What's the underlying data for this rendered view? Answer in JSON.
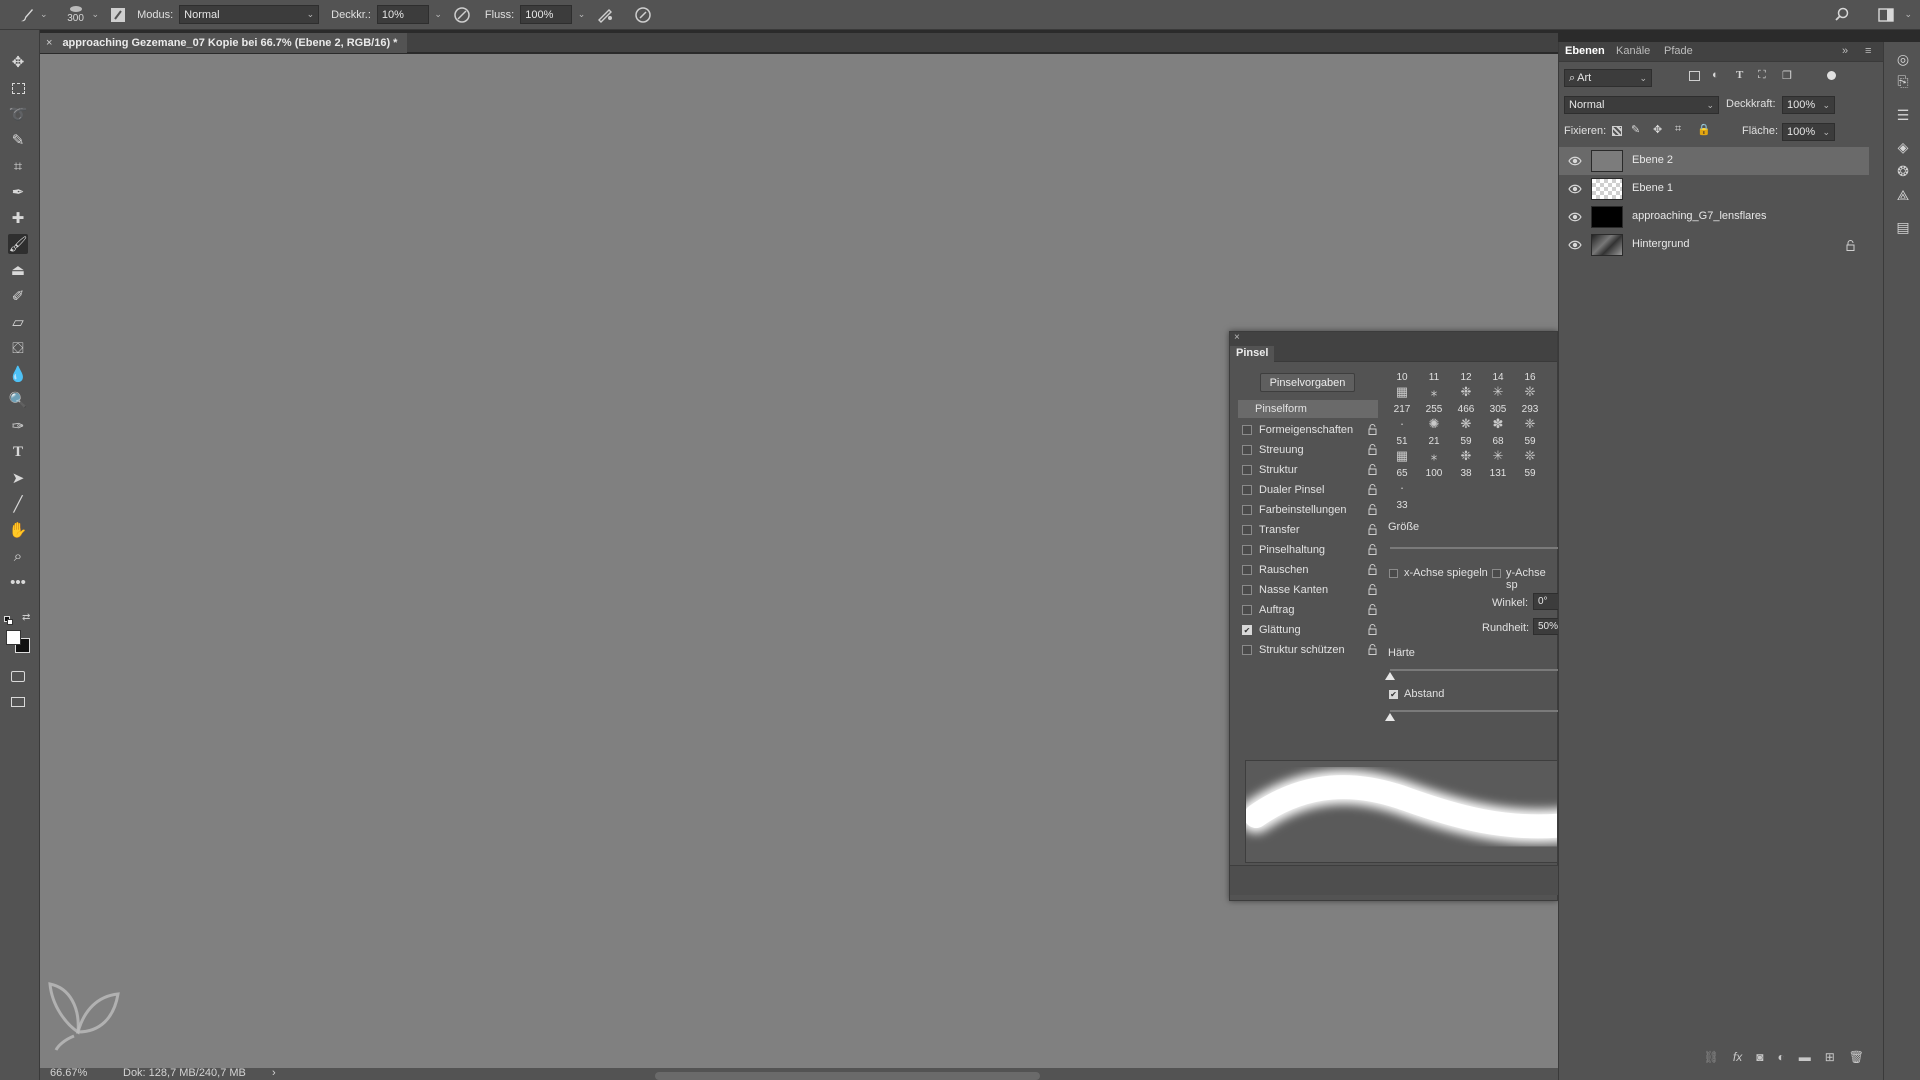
{
  "options_bar": {
    "brush_size": "300",
    "mode_label": "Modus:",
    "mode_value": "Normal",
    "opacity_label": "Deckkr.:",
    "opacity_value": "10%",
    "flow_label": "Fluss:",
    "flow_value": "100%"
  },
  "document": {
    "tab_title": "approaching Gezemane_07 Kopie bei 66.7% (Ebene 2, RGB/16) *",
    "zoom": "66.67%",
    "doc_size": "Dok: 128,7 MB/240,7 MB",
    "canvas_color": "#808080"
  },
  "brush_panel": {
    "title": "Pinsel",
    "presets_button": "Pinselvorgaben",
    "selected_section": "Pinselform",
    "options": [
      {
        "label": "Formeigenschaften",
        "checked": false
      },
      {
        "label": "Streuung",
        "checked": false
      },
      {
        "label": "Struktur",
        "checked": false
      },
      {
        "label": "Dualer Pinsel",
        "checked": false
      },
      {
        "label": "Farbeinstellungen",
        "checked": false
      },
      {
        "label": "Transfer",
        "checked": false
      },
      {
        "label": "Pinselhaltung",
        "checked": false
      },
      {
        "label": "Rauschen",
        "checked": false
      },
      {
        "label": "Nasse Kanten",
        "checked": false
      },
      {
        "label": "Auftrag",
        "checked": false
      },
      {
        "label": "Glättung",
        "checked": true
      },
      {
        "label": "Struktur schützen",
        "checked": false
      }
    ],
    "tip_sizes_row1": [
      "10",
      "11",
      "12",
      "14",
      "16"
    ],
    "tip_sizes_row2": [
      "217",
      "255",
      "466",
      "305",
      "293"
    ],
    "tip_sizes_row3": [
      "51",
      "21",
      "59",
      "68",
      "59"
    ],
    "tip_sizes_row4": [
      "65",
      "100",
      "38",
      "131",
      "59"
    ],
    "tip_sizes_row5": [
      "33"
    ],
    "size_label": "Größe",
    "flip_x_label": "x-Achse spiegeln",
    "flip_y_label": "y-Achse sp",
    "angle_label": "Winkel:",
    "angle_value": "0°",
    "roundness_label": "Rundheit:",
    "roundness_value": "50%",
    "hardness_label": "Härte",
    "spacing_label": "Abstand",
    "spacing_checked": true
  },
  "layers_panel": {
    "tabs": [
      "Ebenen",
      "Kanäle",
      "Pfade"
    ],
    "filter_value": "Art",
    "blend_mode": "Normal",
    "opacity_label": "Deckkraft:",
    "opacity_value": "100%",
    "lock_label": "Fixieren:",
    "fill_label": "Fläche:",
    "fill_value": "100%",
    "layers": [
      {
        "name": "Ebene 2",
        "selected": true,
        "locked": false
      },
      {
        "name": "Ebene 1",
        "selected": false,
        "locked": false
      },
      {
        "name": "approaching_G7_lensflares",
        "selected": false,
        "locked": false
      },
      {
        "name": "Hintergrund",
        "selected": false,
        "locked": true
      }
    ]
  }
}
